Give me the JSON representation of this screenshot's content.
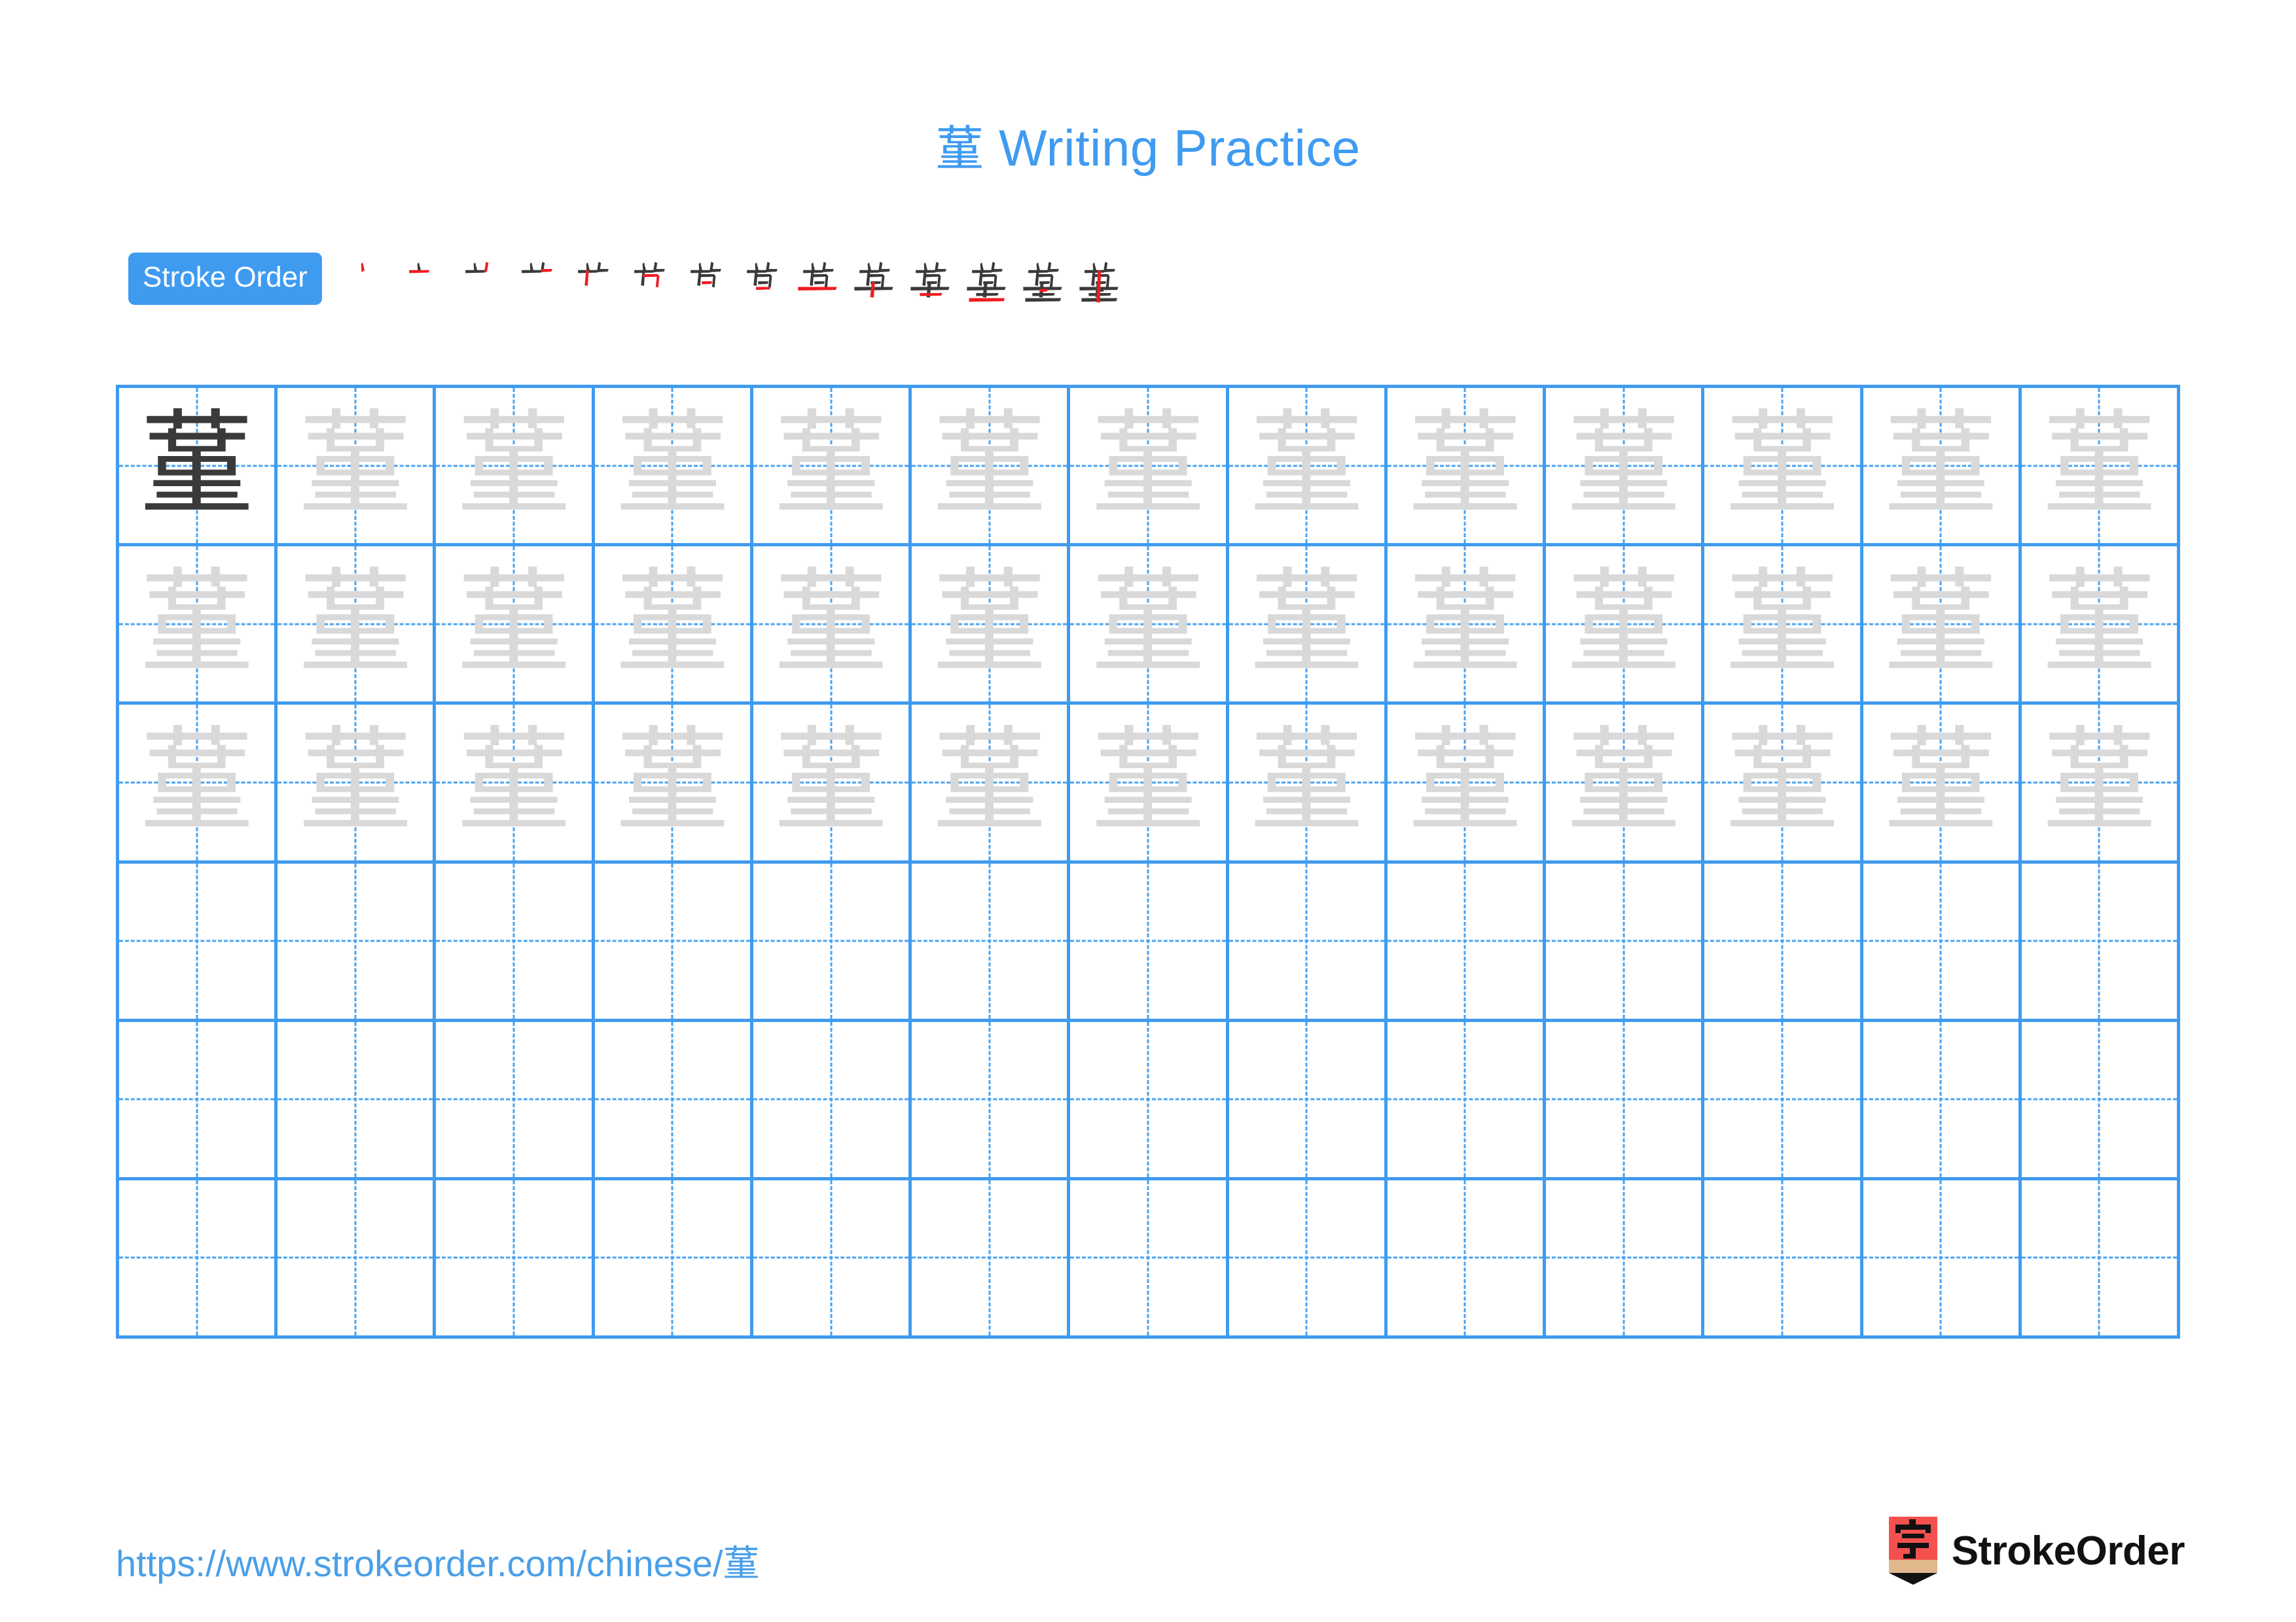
{
  "character": "蓳",
  "header": {
    "title_prefix": "蓳",
    "title_text": " Writing Practice"
  },
  "stroke_order": {
    "badge_label": "Stroke Order",
    "total_strokes": 14,
    "steps": [
      {
        "index": 1,
        "glyph": "丶"
      },
      {
        "index": 2,
        "glyph": "十"
      },
      {
        "index": 3,
        "glyph": "艹"
      },
      {
        "index": 4,
        "glyph": "艹"
      },
      {
        "index": 5,
        "glyph": "艹"
      },
      {
        "index": 6,
        "glyph": "芍"
      },
      {
        "index": 7,
        "glyph": "芐"
      },
      {
        "index": 8,
        "glyph": "苜"
      },
      {
        "index": 9,
        "glyph": "苣"
      },
      {
        "index": 10,
        "glyph": "草"
      },
      {
        "index": 11,
        "glyph": "莗"
      },
      {
        "index": 12,
        "glyph": "菫"
      },
      {
        "index": 13,
        "glyph": "菫"
      },
      {
        "index": 14,
        "glyph": "蓳"
      }
    ]
  },
  "grid": {
    "columns": 13,
    "rows": 6,
    "model_cell": {
      "row": 1,
      "column": 1,
      "glyph": "蓳"
    },
    "trace_glyph": "蓳",
    "trace_rows": 3,
    "blank_rows": 3
  },
  "footer": {
    "url_text": "https://www.strokeorder.com/chinese/",
    "url_character": "蓳",
    "brand_name": "StrokeOrder",
    "brand_mark_char": "字"
  },
  "colors": {
    "accent_blue": "#3f9bf0",
    "grid_blue": "#3f9bf0",
    "guide_blue": "#4aa3f2",
    "model_ink": "#3a3a3a",
    "trace_ink": "#d9d9d9",
    "stroke_highlight_red": "#ee1c23",
    "brand_red": "#f4514e",
    "brand_wood": "#e0b88c"
  }
}
